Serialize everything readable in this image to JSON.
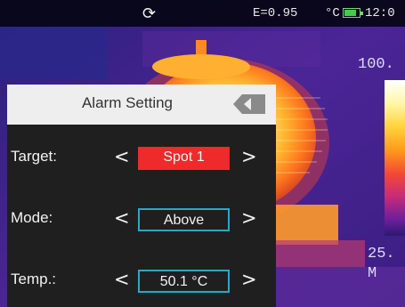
{
  "status_bar": {
    "refresh_icon": "refresh-icon",
    "emissivity": "E=0.95",
    "unit": "°C",
    "battery_icon": "battery-icon",
    "battery_level": 0.8,
    "clock": "12:0"
  },
  "scale": {
    "max_label": "100.",
    "min_label": "25.",
    "mode": "M"
  },
  "dialog": {
    "title": "Alarm Setting",
    "back_icon": "back-icon",
    "rows": [
      {
        "label": "Target:",
        "value": "Spot 1"
      },
      {
        "label": "Mode:",
        "value": "Above"
      },
      {
        "label": "Temp.:",
        "value": "50.1 °C"
      }
    ],
    "left_arrow": "<",
    "right_arrow": ">"
  },
  "colors": {
    "selected": "#ee2a2a",
    "box_border": "#2aa8c8",
    "panel": "#1f1f1f",
    "header": "#eeeeee"
  }
}
